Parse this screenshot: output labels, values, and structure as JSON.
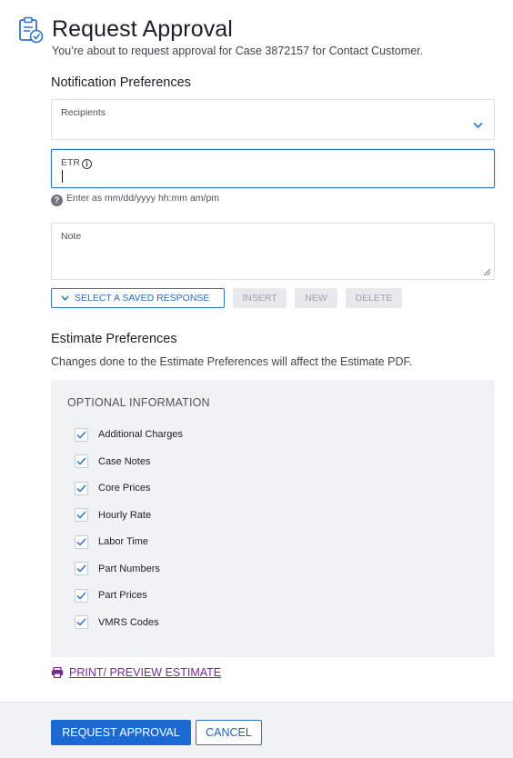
{
  "header": {
    "title": "Request Approval",
    "subtitle": "You’re about to request approval for Case 3872157 for Contact Customer.",
    "icon": "clipboard-check-icon"
  },
  "notification": {
    "title": "Notification Preferences",
    "recipients_label": "Recipients",
    "recipients_value": "",
    "etr_label": "ETR",
    "etr_value": "",
    "etr_hint": "Enter as mm/dd/yyyy hh:mm am/pm",
    "note_label": "Note",
    "note_value": ""
  },
  "response_buttons": {
    "saved": "SELECT A SAVED RESPONSE",
    "insert": "INSERT",
    "new": "NEW",
    "delete": "DELETE"
  },
  "estimate": {
    "title": "Estimate Preferences",
    "description": "Changes done to the Estimate Preferences will affect the Estimate PDF.",
    "options_title": "OPTIONAL INFORMATION",
    "options": [
      {
        "label": "Additional Charges",
        "checked": true
      },
      {
        "label": "Case Notes",
        "checked": true
      },
      {
        "label": "Core Prices",
        "checked": true
      },
      {
        "label": "Hourly Rate",
        "checked": true
      },
      {
        "label": "Labor Time",
        "checked": true
      },
      {
        "label": "Part Numbers",
        "checked": true
      },
      {
        "label": "Part Prices",
        "checked": true
      },
      {
        "label": "VMRS Codes",
        "checked": true
      }
    ],
    "print_link": "PRINT/ PREVIEW ESTIMATE"
  },
  "footer": {
    "request_label": "REQUEST APPROVAL",
    "cancel_label": "CANCEL"
  },
  "colors": {
    "accent": "#1b6ad1",
    "link": "#7a2a8f",
    "panel": "#f1f2f4"
  }
}
